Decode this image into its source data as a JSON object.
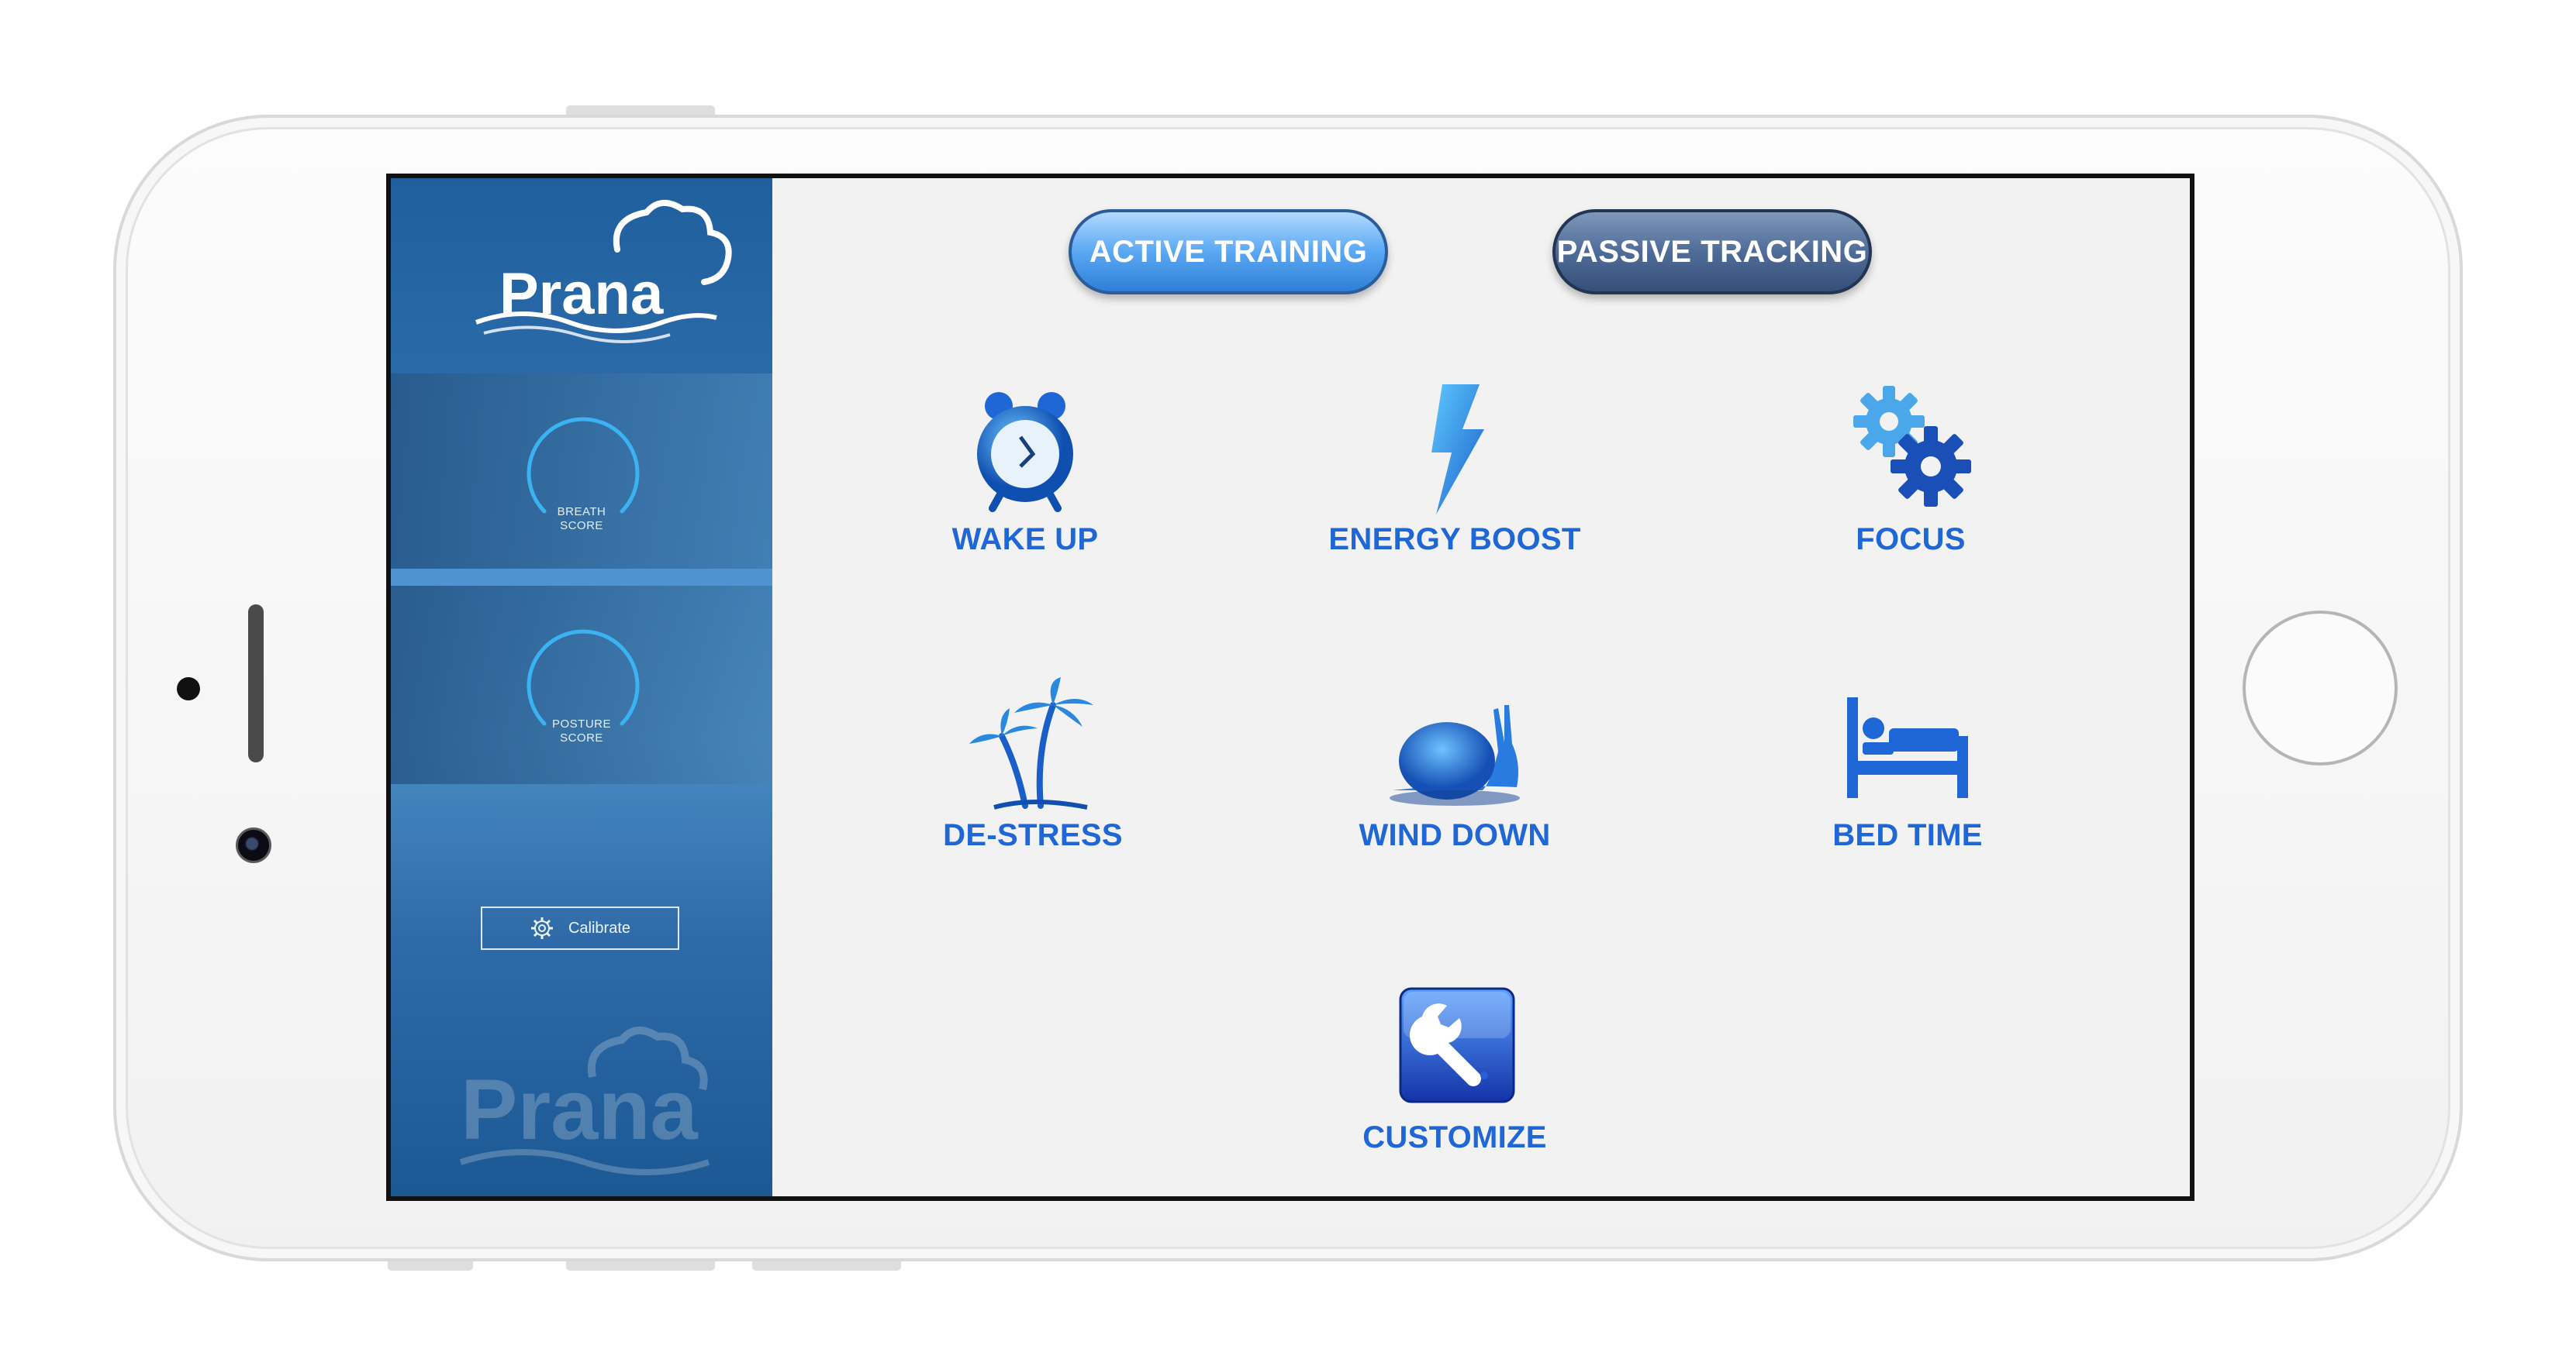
{
  "app": {
    "name": "Prana",
    "watermark": "Prana"
  },
  "sidebar": {
    "breath_score": {
      "line1": "BREATH",
      "line2": "SCORE"
    },
    "posture_score": {
      "line1": "POSTURE",
      "line2": "SCORE"
    },
    "calibrate_label": "Calibrate"
  },
  "modes": {
    "active": "ACTIVE TRAINING",
    "passive": "PASSIVE TRACKING"
  },
  "tiles": [
    {
      "label": "WAKE UP",
      "icon": "alarm-clock-icon"
    },
    {
      "label": "ENERGY BOOST",
      "icon": "lightning-bolt-icon"
    },
    {
      "label": "FOCUS",
      "icon": "gears-icon"
    },
    {
      "label": "DE-STRESS",
      "icon": "palm-trees-icon"
    },
    {
      "label": "WIND DOWN",
      "icon": "snail-icon"
    },
    {
      "label": "BED TIME",
      "icon": "bed-icon"
    },
    {
      "label": "CUSTOMIZE",
      "icon": "wrench-icon"
    }
  ],
  "colors": {
    "accent_blue": "#1f66d6",
    "sidebar_blue": "#2e6aa7",
    "gauge_cyan": "#3bb3f3"
  }
}
